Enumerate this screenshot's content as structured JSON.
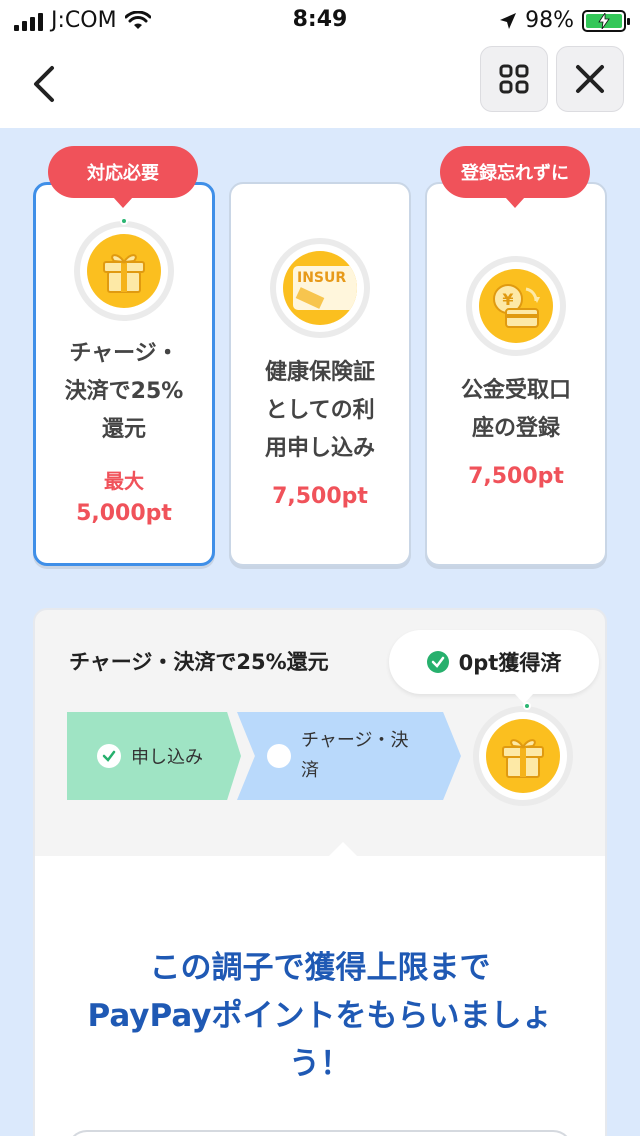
{
  "status_bar": {
    "carrier": "J:COM",
    "time": "8:49",
    "battery": "98%"
  },
  "nav": {
    "back_icon": "chevron-left-icon",
    "grid_icon": "grid-icon",
    "close_icon": "close-icon"
  },
  "cards": [
    {
      "badge": "対応必要",
      "title_lines": [
        "チャージ・",
        "決済で25%",
        "還元"
      ],
      "sub": "最大",
      "points": "5,000pt",
      "icon": "gift-icon"
    },
    {
      "badge": "",
      "title_lines": [
        "健康保険証",
        "としての利",
        "用申し込み"
      ],
      "sub": "",
      "points": "7,500pt",
      "icon": "insurance-card-icon",
      "icon_text": "INSUR"
    },
    {
      "badge": "登録忘れずに",
      "title_lines": [
        "公金受取口",
        "座の登録"
      ],
      "sub": "",
      "points": "7,500pt",
      "icon": "yen-card-icon",
      "icon_text": "¥"
    }
  ],
  "panel": {
    "title": "チャージ・決済で25%還元",
    "earned": "0pt獲得済",
    "steps": [
      {
        "label": "申し込み",
        "done": true
      },
      {
        "label": "チャージ・決済",
        "done": false
      }
    ],
    "promo_lines": [
      "この調子で獲得上限まで",
      "PayPayポイントをもらいましょ",
      "う！"
    ]
  },
  "colors": {
    "accent_blue": "#3f8fe8",
    "badge_red": "#f0525a",
    "promo_blue": "#1f59b4",
    "background_blue": "#dbe9fc",
    "gift_yellow": "#fbbf1f",
    "done_green": "#9fe4c4"
  }
}
